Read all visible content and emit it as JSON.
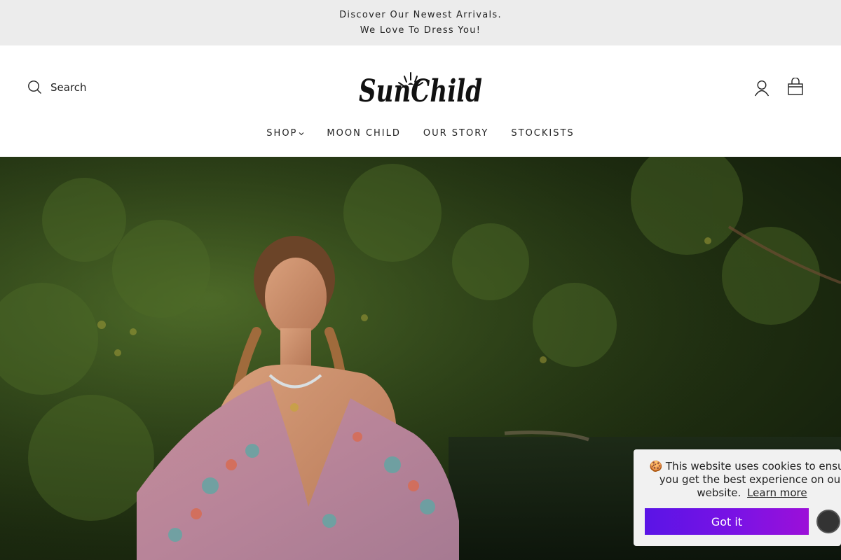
{
  "announcement": {
    "line1": "Discover Our Newest Arrivals.",
    "line2": "We Love To Dress You!"
  },
  "header": {
    "search_label": "Search",
    "logo_text": "SunChild",
    "icons": {
      "search": "search-icon",
      "account": "user-icon",
      "cart": "shopping-bag-icon"
    }
  },
  "nav": {
    "items": [
      {
        "label": "SHOP",
        "has_dropdown": true
      },
      {
        "label": "MOON CHILD"
      },
      {
        "label": "OUR STORY"
      },
      {
        "label": "STOCKISTS"
      }
    ]
  },
  "hero": {
    "image": "model in pink floral kimono with braided hair in jungle by river"
  },
  "cookie_banner": {
    "emoji": "🍪",
    "message": "This website uses cookies to ensure you get the best experience on our website.",
    "learn_more": "Learn more",
    "accept_label": "Got it",
    "accent": "#6a12e6"
  }
}
